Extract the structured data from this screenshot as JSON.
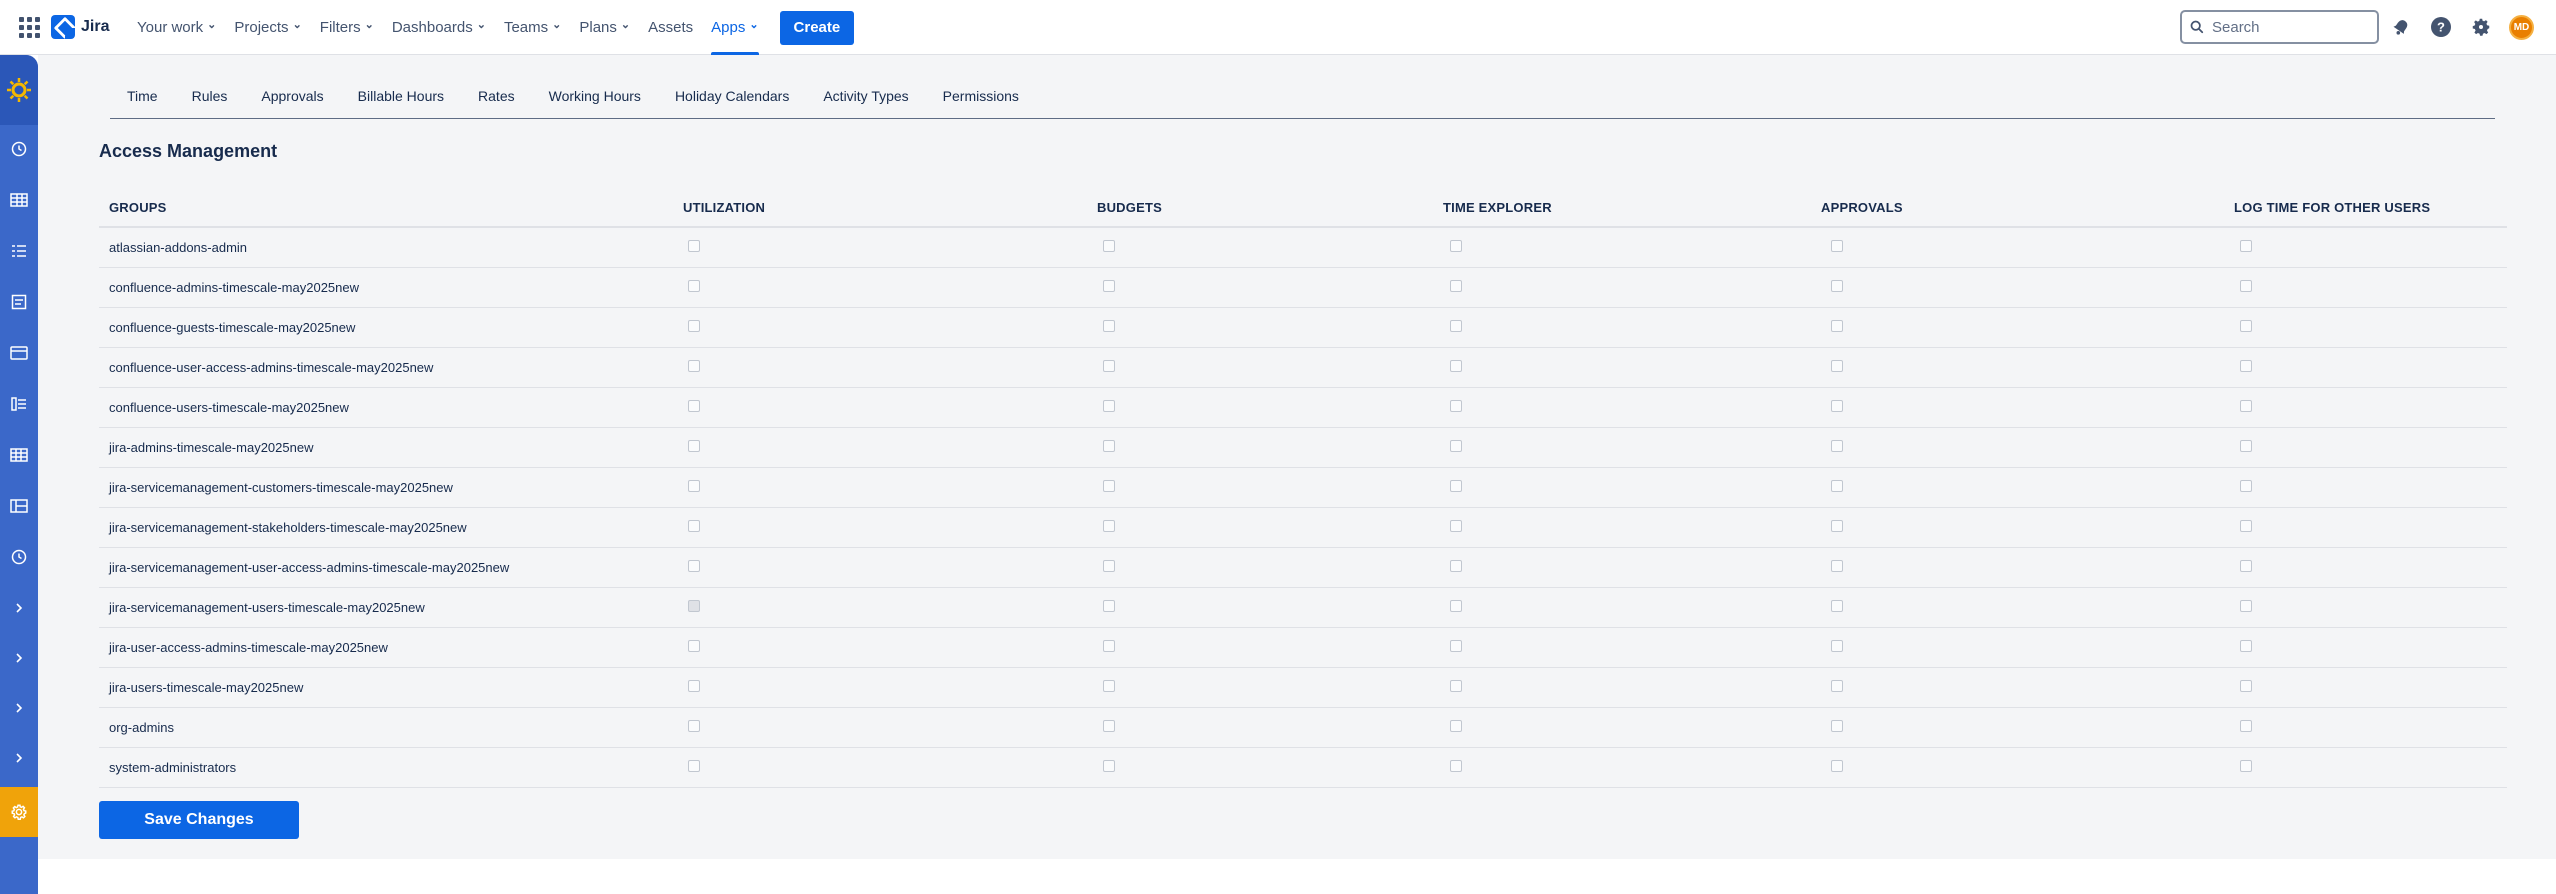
{
  "topnav": {
    "logo_text": "Jira",
    "items": [
      {
        "label": "Your work",
        "has_menu": true
      },
      {
        "label": "Projects",
        "has_menu": true
      },
      {
        "label": "Filters",
        "has_menu": true
      },
      {
        "label": "Dashboards",
        "has_menu": true
      },
      {
        "label": "Teams",
        "has_menu": true
      },
      {
        "label": "Plans",
        "has_menu": true
      },
      {
        "label": "Assets",
        "has_menu": false
      },
      {
        "label": "Apps",
        "has_menu": true,
        "active": true
      }
    ],
    "create_label": "Create",
    "search_placeholder": "Search",
    "avatar_initials": "MD"
  },
  "tabs": [
    "Time",
    "Rules",
    "Approvals",
    "Billable Hours",
    "Rates",
    "Working Hours",
    "Holiday Calendars",
    "Activity Types",
    "Permissions"
  ],
  "section_title": "Access Management",
  "table": {
    "headers": [
      "GROUPS",
      "UTILIZATION",
      "BUDGETS",
      "TIME EXPLORER",
      "APPROVALS",
      "LOG TIME FOR OTHER USERS"
    ],
    "rows": [
      {
        "group": "atlassian-addons-admin",
        "checks": [
          false,
          false,
          false,
          false,
          false
        ]
      },
      {
        "group": "confluence-admins-timescale-may2025new",
        "checks": [
          false,
          false,
          false,
          false,
          false
        ]
      },
      {
        "group": "confluence-guests-timescale-may2025new",
        "checks": [
          false,
          false,
          false,
          false,
          false
        ]
      },
      {
        "group": "confluence-user-access-admins-timescale-may2025new",
        "checks": [
          false,
          false,
          false,
          false,
          false
        ]
      },
      {
        "group": "confluence-users-timescale-may2025new",
        "checks": [
          false,
          false,
          false,
          false,
          false
        ]
      },
      {
        "group": "jira-admins-timescale-may2025new",
        "checks": [
          false,
          false,
          false,
          false,
          false
        ]
      },
      {
        "group": "jira-servicemanagement-customers-timescale-may2025new",
        "checks": [
          false,
          false,
          false,
          false,
          false
        ]
      },
      {
        "group": "jira-servicemanagement-stakeholders-timescale-may2025new",
        "checks": [
          false,
          false,
          false,
          false,
          false
        ]
      },
      {
        "group": "jira-servicemanagement-user-access-admins-timescale-may2025new",
        "checks": [
          false,
          false,
          false,
          false,
          false
        ]
      },
      {
        "group": "jira-servicemanagement-users-timescale-may2025new",
        "checks": [
          false,
          false,
          false,
          false,
          false
        ],
        "utilization_disabled": true
      },
      {
        "group": "jira-user-access-admins-timescale-may2025new",
        "checks": [
          false,
          false,
          false,
          false,
          false
        ]
      },
      {
        "group": "jira-users-timescale-may2025new",
        "checks": [
          false,
          false,
          false,
          false,
          false
        ]
      },
      {
        "group": "org-admins",
        "checks": [
          false,
          false,
          false,
          false,
          false
        ]
      },
      {
        "group": "system-administrators",
        "checks": [
          false,
          false,
          false,
          false,
          false
        ]
      }
    ]
  },
  "save_label": "Save Changes",
  "colors": {
    "primary": "#0c66e4",
    "sidebar": "#3b68c9",
    "sidebar_accent": "#f0a30a",
    "avatar": "#e97f00"
  }
}
